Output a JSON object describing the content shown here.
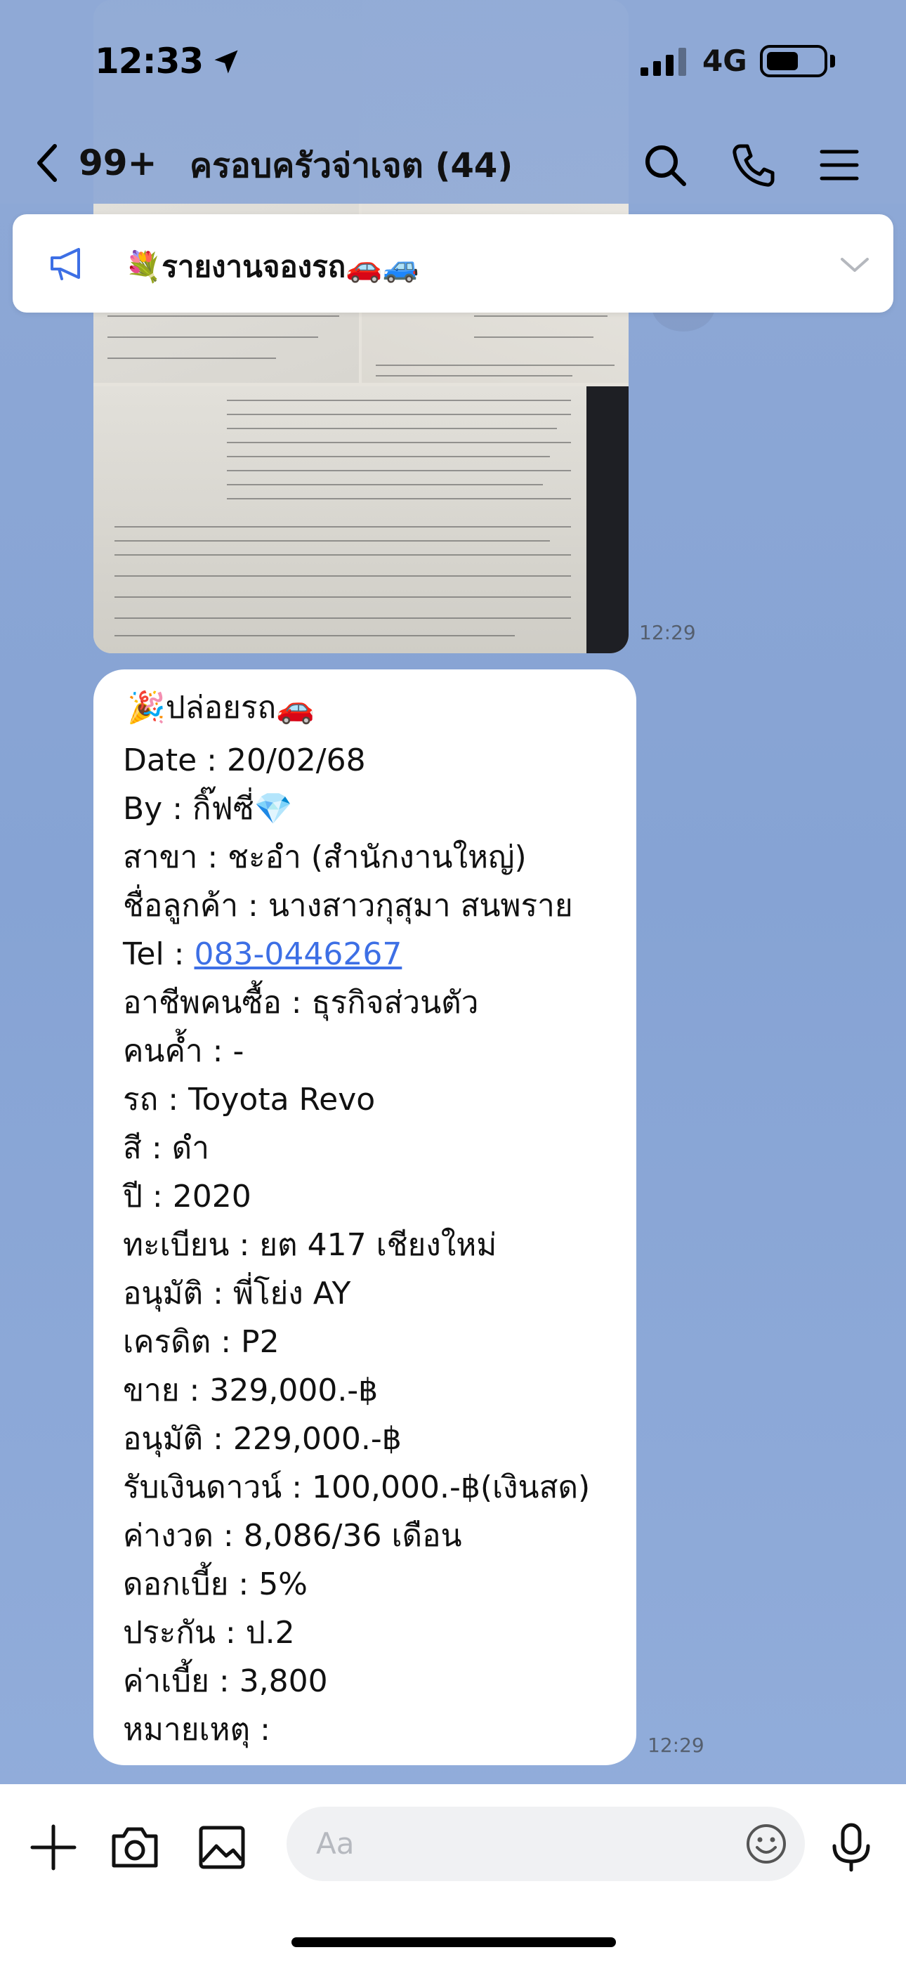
{
  "status_bar": {
    "time": "12:33",
    "network": "4G"
  },
  "nav": {
    "back_count": "99+",
    "title": "ครอบครัวจ่าเจต (44)"
  },
  "announcement": {
    "text": "💐รายงานจองรถ🚗🚙"
  },
  "messages": {
    "image_time": "12:29",
    "text_time": "12:29",
    "lines": {
      "header": "🎉ปล่อยรถ🚗",
      "date": "Date : 20/02/68",
      "by": "By : กิ๊ฟซี่💎",
      "branch": "สาขา : ชะอำ (สำนักงานใหญ่)",
      "customer": "ชื่อลูกค้า : นางสาวกุสุมา สนพราย",
      "tel_label": "Tel : ",
      "tel_number": "083-0446267",
      "occupation": "อาชีพคนซื้อ : ธุรกิจส่วนตัว",
      "guarantor": "คนค้ำ : -",
      "car": "รถ : Toyota Revo",
      "color": "สี : ดำ",
      "year": "ปี : 2020",
      "registration": "ทะเบียน : ยต 417 เชียงใหม่",
      "approver": "อนุมัติ : พี่โย่ง AY",
      "credit": "เครดิต : P2",
      "sale": "ขาย : 329,000.-฿",
      "approved_amount": "อนุมัติ : 229,000.-฿",
      "down_payment": "รับเงินดาวน์ : 100,000.-฿(เงินสด)",
      "installment": "ค่างวด : 8,086/36 เดือน",
      "interest": "ดอกเบี้ย : 5%",
      "insurance": "ประกัน : ป.2",
      "premium": "ค่าเบี้ย : 3,800",
      "note": "หมายเหตุ :"
    }
  },
  "input": {
    "placeholder": "Aa"
  },
  "colors": {
    "background": "#8fa9d6",
    "link": "#3d6fe5",
    "announce_icon": "#3d6fe5"
  },
  "icons": [
    "location-arrow-icon",
    "signal-icon",
    "battery-icon",
    "back-chevron-icon",
    "search-icon",
    "phone-icon",
    "menu-icon",
    "megaphone-icon",
    "chevron-down-icon",
    "plus-icon",
    "camera-icon",
    "image-icon",
    "emoji-icon",
    "microphone-icon"
  ]
}
